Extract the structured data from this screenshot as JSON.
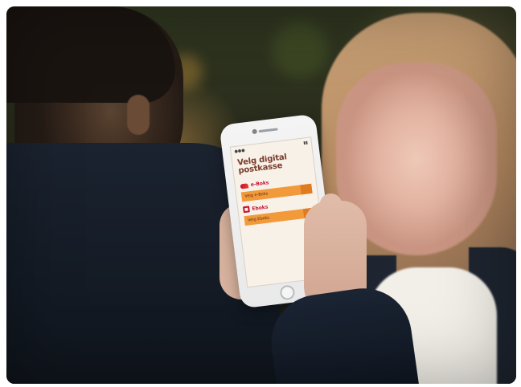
{
  "photo": {
    "phone_screen": {
      "title": "Velg digital postkasse",
      "subtitle": "",
      "options": [
        {
          "bank_name": "e-Boks",
          "button_label": "Velg e-Boks"
        },
        {
          "bank_name": "Eboks",
          "button_label": "Velg Eboks"
        }
      ]
    }
  }
}
